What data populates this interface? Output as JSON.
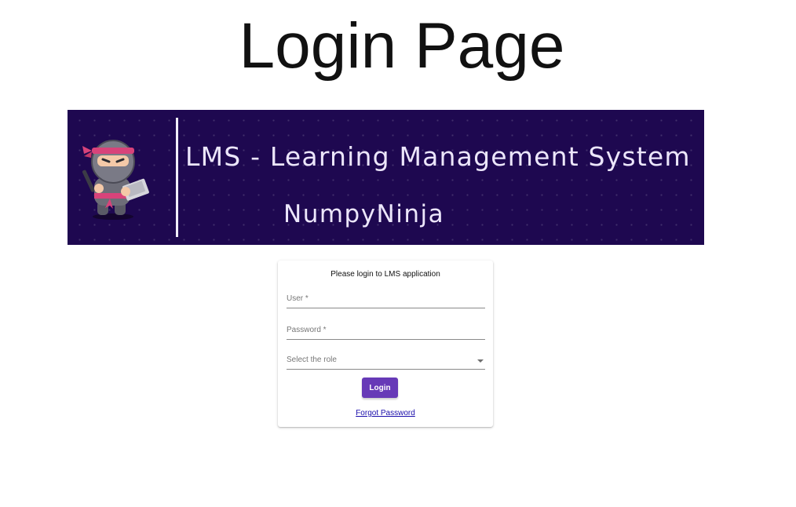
{
  "page": {
    "title": "Login Page"
  },
  "banner": {
    "title": "LMS - Learning Management System",
    "subtitle": "NumpyNinja",
    "mascot_icon": "ninja-with-laptop",
    "background_color": "#1e0850"
  },
  "login_card": {
    "heading": "Please login to LMS application",
    "user_field": {
      "placeholder": "User *",
      "value": ""
    },
    "password_field": {
      "placeholder": "Password *",
      "value": ""
    },
    "role_select": {
      "placeholder": "Select the role",
      "icon": "caret-down-icon"
    },
    "login_button": {
      "label": "Login",
      "color": "#673ab7"
    },
    "forgot_password_link": "Forgot Password"
  }
}
